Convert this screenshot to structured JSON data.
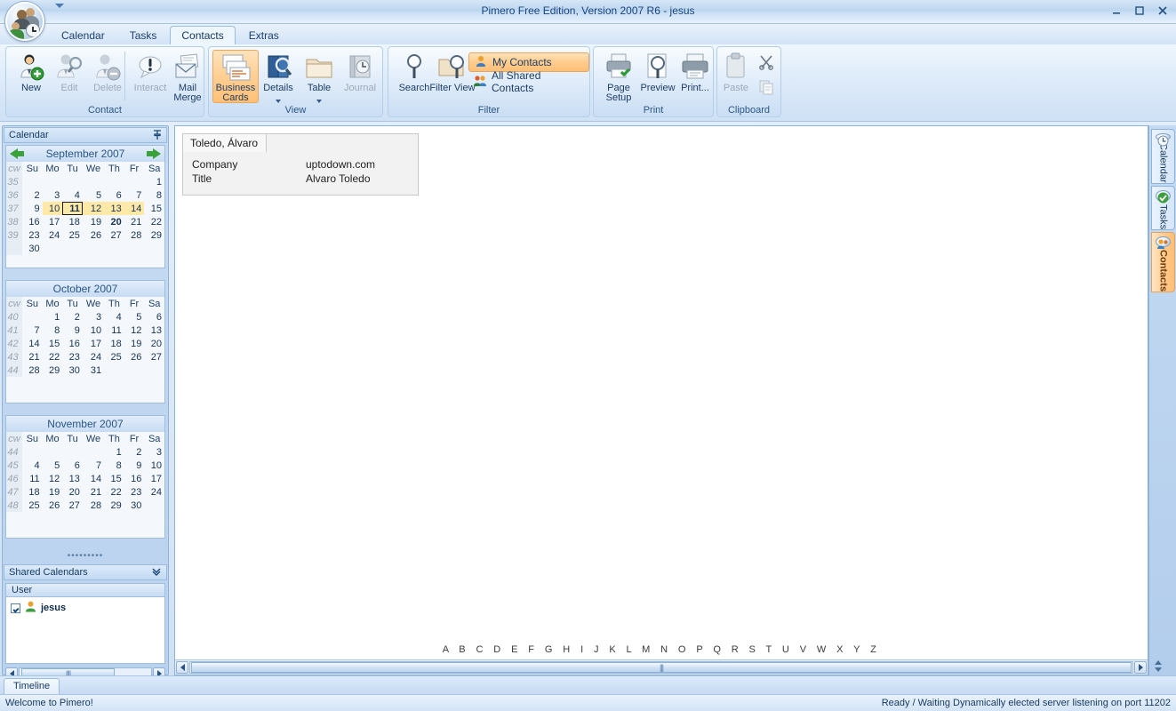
{
  "window": {
    "title": "Pimero Free Edition, Version 2007 R6 - jesus",
    "minimize": "minimize-icon",
    "maximize": "maximize-icon",
    "close": "close-icon",
    "logo": "pimero-logo-icon"
  },
  "tabs": [
    {
      "label": "Calendar",
      "active": false
    },
    {
      "label": "Tasks",
      "active": false
    },
    {
      "label": "Contacts",
      "active": true
    },
    {
      "label": "Extras",
      "active": false
    }
  ],
  "ribbon": {
    "groups": [
      {
        "name": "Contact",
        "label": "Contact",
        "buttons": [
          {
            "label": "New",
            "icon": "person-add-icon",
            "disabled": false,
            "selected": false
          },
          {
            "label": "Edit",
            "icon": "person-search-icon",
            "disabled": true,
            "selected": false
          },
          {
            "label": "Delete",
            "icon": "person-remove-icon",
            "disabled": true,
            "selected": false
          },
          {
            "label": "Interact",
            "icon": "speech-bubble-icon",
            "disabled": true,
            "selected": false
          },
          {
            "label": "Mail Merge",
            "icon": "mail-merge-icon",
            "disabled": false,
            "selected": false
          }
        ]
      },
      {
        "name": "View",
        "label": "View",
        "buttons": [
          {
            "label": "Business Cards",
            "icon": "business-cards-icon",
            "disabled": false,
            "selected": true
          },
          {
            "label": "Details",
            "icon": "details-book-icon",
            "disabled": false,
            "selected": false,
            "dropdown": true
          },
          {
            "label": "Table",
            "icon": "table-folder-icon",
            "disabled": false,
            "selected": false,
            "dropdown": true
          },
          {
            "label": "Journal",
            "icon": "journal-clock-icon",
            "disabled": true,
            "selected": false
          }
        ]
      },
      {
        "name": "Filter",
        "label": "Filter",
        "buttons": [
          {
            "label": "Search",
            "icon": "magnifier-icon",
            "disabled": false,
            "selected": false
          },
          {
            "label": "Filter View",
            "icon": "filter-view-icon",
            "disabled": false,
            "selected": false
          }
        ],
        "list": [
          {
            "label": "My Contacts",
            "icon": "single-person-icon",
            "selected": true
          },
          {
            "label": "All Shared Contacts",
            "icon": "group-people-icon",
            "selected": false
          }
        ]
      },
      {
        "name": "Print",
        "label": "Print",
        "buttons": [
          {
            "label": "Page Setup",
            "icon": "page-setup-icon",
            "disabled": false,
            "selected": false
          },
          {
            "label": "Preview",
            "icon": "print-preview-icon",
            "disabled": false,
            "selected": false
          },
          {
            "label": "Print...",
            "icon": "printer-icon",
            "disabled": false,
            "selected": false
          }
        ]
      },
      {
        "name": "Clipboard",
        "label": "Clipboard",
        "buttons": [
          {
            "label": "Paste",
            "icon": "clipboard-paste-icon",
            "disabled": true,
            "selected": false
          },
          {
            "label": "",
            "icon": "cut-scissors-icon",
            "disabled": false,
            "selected": false
          },
          {
            "label": "",
            "icon": "copy-icon",
            "disabled": true,
            "selected": false
          }
        ]
      }
    ]
  },
  "sidebar": {
    "header": {
      "title": "Calendar",
      "pin": "pin-icon"
    },
    "months": [
      {
        "title": "September 2007",
        "prev": "prev-month-arrow-icon",
        "next": "next-month-arrow-icon",
        "day_headers": [
          "cw",
          "Su",
          "Mo",
          "Tu",
          "We",
          "Th",
          "Fr",
          "Sa"
        ],
        "weeks": [
          {
            "cw": "35",
            "days": [
              "",
              "",
              "",
              "",
              "",
              "",
              "1"
            ]
          },
          {
            "cw": "36",
            "days": [
              "2",
              "3",
              "4",
              "5",
              "6",
              "7",
              "8"
            ]
          },
          {
            "cw": "37",
            "days": [
              "9",
              "10",
              "11",
              "12",
              "13",
              "14",
              "15"
            ]
          },
          {
            "cw": "38",
            "days": [
              "16",
              "17",
              "18",
              "19",
              "20",
              "21",
              "22"
            ]
          },
          {
            "cw": "39",
            "days": [
              "23",
              "24",
              "25",
              "26",
              "27",
              "28",
              "29"
            ]
          },
          {
            "cw": "",
            "days": [
              "30",
              "",
              "",
              "",
              "",
              "",
              ""
            ]
          }
        ],
        "highlight_week_index": 2,
        "highlight_cols": [
          1,
          2,
          3,
          4,
          5
        ],
        "selected": {
          "week": 2,
          "col": 2,
          "day": "11"
        },
        "bold": {
          "week": 3,
          "col": 4,
          "day": "20"
        }
      },
      {
        "title": "October 2007",
        "day_headers": [
          "cw",
          "Su",
          "Mo",
          "Tu",
          "We",
          "Th",
          "Fr",
          "Sa"
        ],
        "weeks": [
          {
            "cw": "40",
            "days": [
              "",
              "1",
              "2",
              "3",
              "4",
              "5",
              "6"
            ]
          },
          {
            "cw": "41",
            "days": [
              "7",
              "8",
              "9",
              "10",
              "11",
              "12",
              "13"
            ]
          },
          {
            "cw": "42",
            "days": [
              "14",
              "15",
              "16",
              "17",
              "18",
              "19",
              "20"
            ]
          },
          {
            "cw": "43",
            "days": [
              "21",
              "22",
              "23",
              "24",
              "25",
              "26",
              "27"
            ]
          },
          {
            "cw": "44",
            "days": [
              "28",
              "29",
              "30",
              "31",
              "",
              "",
              ""
            ]
          }
        ]
      },
      {
        "title": "November 2007",
        "day_headers": [
          "cw",
          "Su",
          "Mo",
          "Tu",
          "We",
          "Th",
          "Fr",
          "Sa"
        ],
        "weeks": [
          {
            "cw": "44",
            "days": [
              "",
              "",
              "",
              "",
              "1",
              "2",
              "3"
            ]
          },
          {
            "cw": "45",
            "days": [
              "4",
              "5",
              "6",
              "7",
              "8",
              "9",
              "10"
            ]
          },
          {
            "cw": "46",
            "days": [
              "11",
              "12",
              "13",
              "14",
              "15",
              "16",
              "17"
            ]
          },
          {
            "cw": "47",
            "days": [
              "18",
              "19",
              "20",
              "21",
              "22",
              "23",
              "24"
            ]
          },
          {
            "cw": "48",
            "days": [
              "25",
              "26",
              "27",
              "28",
              "29",
              "30",
              ""
            ]
          }
        ]
      }
    ],
    "shared": {
      "title": "Shared Calendars",
      "collapse_icon": "chevron-double-down-icon",
      "column_header": "User",
      "users": [
        {
          "name": "jesus",
          "checked": true,
          "icon": "user-icon"
        }
      ]
    }
  },
  "main": {
    "contact_card": {
      "name": "Toledo, Álvaro",
      "fields": [
        {
          "key": "Company",
          "value": "uptodown.com"
        },
        {
          "key": "Title",
          "value": "Alvaro Toledo"
        }
      ]
    },
    "alphabet": "A B C D E F G H I J K L M N O P Q R S T U V W X Y Z"
  },
  "right_dock": {
    "tabs": [
      {
        "label": "Calendar",
        "icon": "clock-icon",
        "active": false
      },
      {
        "label": "Tasks",
        "icon": "task-check-icon",
        "active": false
      },
      {
        "label": "Contacts",
        "icon": "contacts-icon",
        "active": true
      }
    ]
  },
  "bottom": {
    "tab": "Timeline",
    "status_left": "Welcome to Pimero!",
    "status_right": "Ready / Waiting  Dynamically elected server listening on port 11202"
  },
  "colors": {
    "accent_orange": "#ffbf77",
    "title_blue": "#16437e",
    "panel_blue": "#c3d9f0",
    "highlight_yellow": "#ffe9a8"
  }
}
